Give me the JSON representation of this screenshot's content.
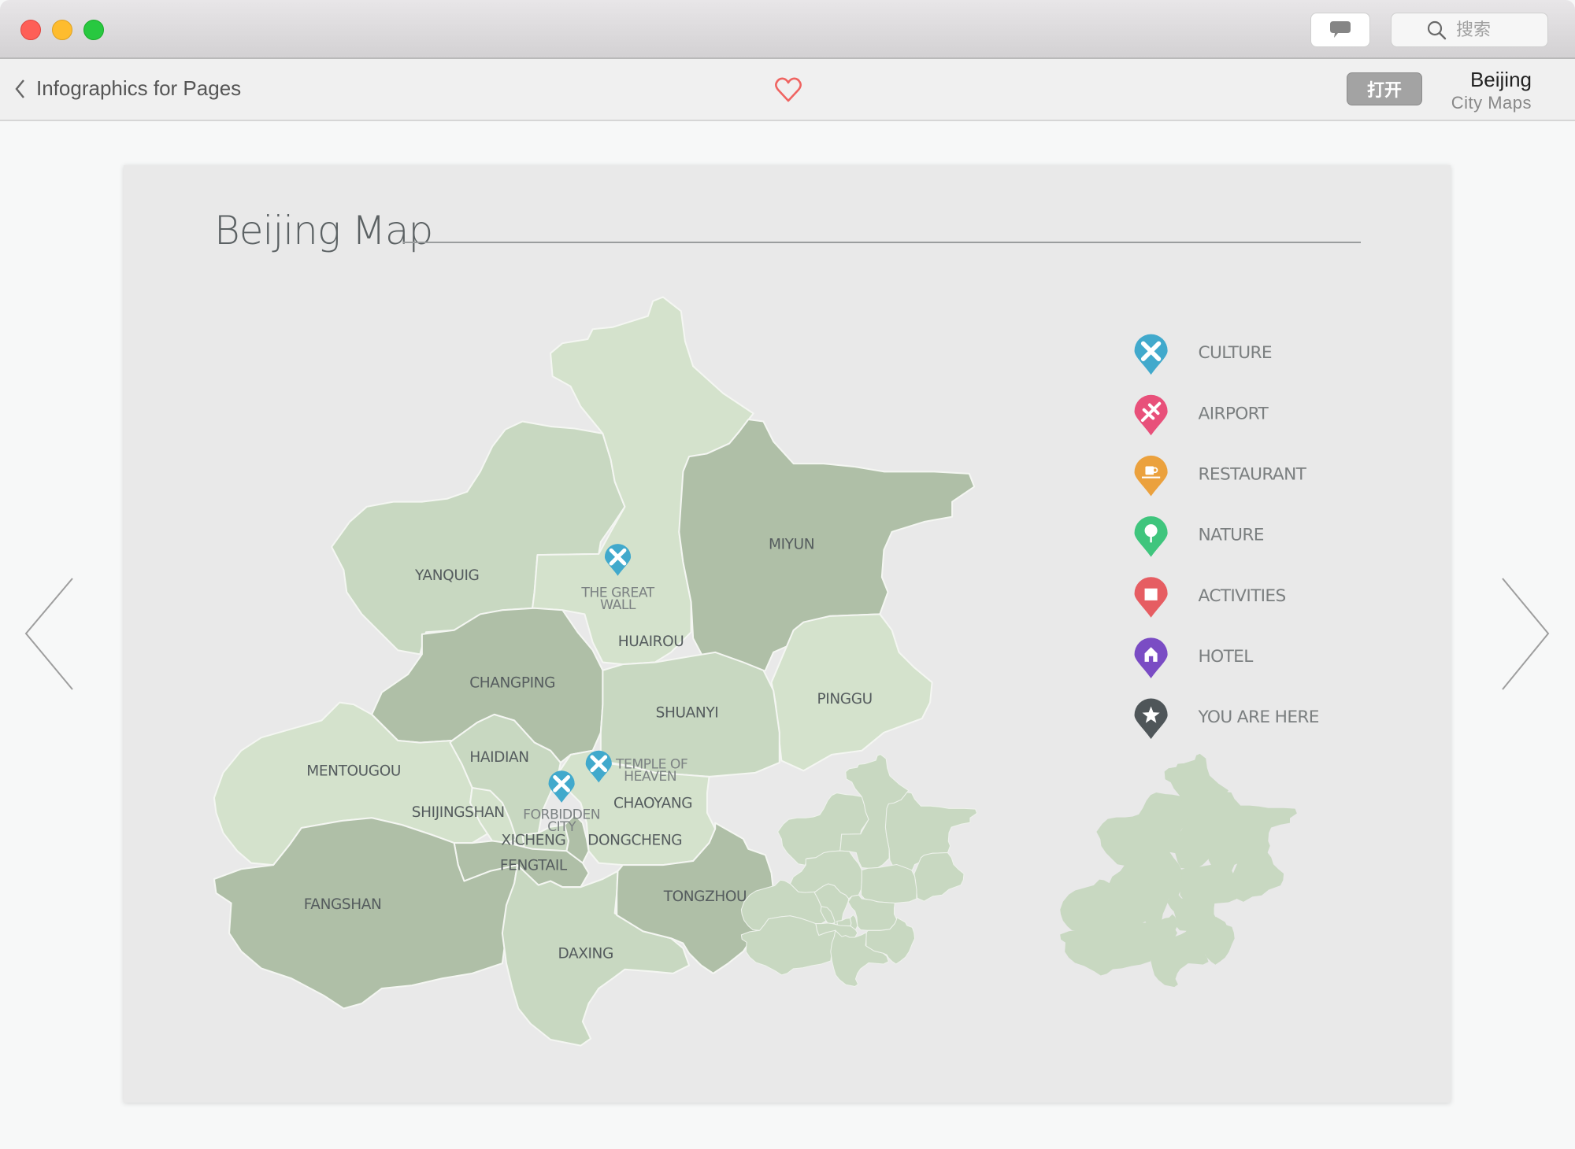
{
  "window": {
    "search_placeholder": "搜索",
    "chat_icon": "speech-bubble-icon",
    "search_icon": "magnifier-icon"
  },
  "toolbar": {
    "back_label": "Infographics for Pages",
    "favorite_icon": "heart-outline-icon",
    "open_label": "打开",
    "item_title": "Beijing",
    "item_subtitle": "City Maps"
  },
  "colors": {
    "heart": "#ef6461",
    "district_dark": "#afbfa7",
    "district_mid": "#c8d8c1",
    "district_light": "#d4e2cc",
    "card_bg": "#e9e9e9"
  },
  "preview": {
    "title": "Beijing Map",
    "districts": [
      {
        "name": "YANQUIG",
        "shade": "mid"
      },
      {
        "name": "HUAIROU",
        "shade": "light"
      },
      {
        "name": "MIYUN",
        "shade": "dark"
      },
      {
        "name": "PINGGU",
        "shade": "light"
      },
      {
        "name": "CHANGPING",
        "shade": "dark"
      },
      {
        "name": "SHUANYI",
        "shade": "mid"
      },
      {
        "name": "MENTOUGOU",
        "shade": "light"
      },
      {
        "name": "HAIDIAN",
        "shade": "mid"
      },
      {
        "name": "SHIJINGSHAN",
        "shade": "light"
      },
      {
        "name": "CHAOYANG",
        "shade": "light"
      },
      {
        "name": "XICHENG",
        "shade": "mid"
      },
      {
        "name": "DONGCHENG",
        "shade": "dark"
      },
      {
        "name": "FENGTAIL",
        "shade": "dark"
      },
      {
        "name": "FANGSHAN",
        "shade": "dark"
      },
      {
        "name": "DAXING",
        "shade": "mid"
      },
      {
        "name": "TONGZHOU",
        "shade": "dark"
      }
    ],
    "points_of_interest": [
      {
        "line1": "THE GREAT",
        "line2": "WALL",
        "category": "CULTURE"
      },
      {
        "line1": "TEMPLE OF",
        "line2": "HEAVEN",
        "category": "CULTURE"
      },
      {
        "line1": "FORBIDDEN",
        "line2": "CITY",
        "category": "CULTURE"
      }
    ],
    "legend": [
      {
        "label": "CULTURE",
        "color": "#41a9cc",
        "icon": "brush-pencil-icon"
      },
      {
        "label": "AIRPORT",
        "color": "#e8507a",
        "icon": "airplane-icon"
      },
      {
        "label": "RESTAURANT",
        "color": "#eba13d",
        "icon": "coffee-cup-icon"
      },
      {
        "label": "NATURE",
        "color": "#3fc57d",
        "icon": "tree-icon"
      },
      {
        "label": "ACTIVITIES",
        "color": "#e65d62",
        "icon": "shopping-bag-icon"
      },
      {
        "label": "HOTEL",
        "color": "#7a4cc4",
        "icon": "house-icon"
      },
      {
        "label": "YOU ARE HERE",
        "color": "#4f5659",
        "icon": "star-icon"
      }
    ]
  },
  "navigation": {
    "prev_icon": "chevron-left-icon",
    "next_icon": "chevron-right-icon"
  }
}
